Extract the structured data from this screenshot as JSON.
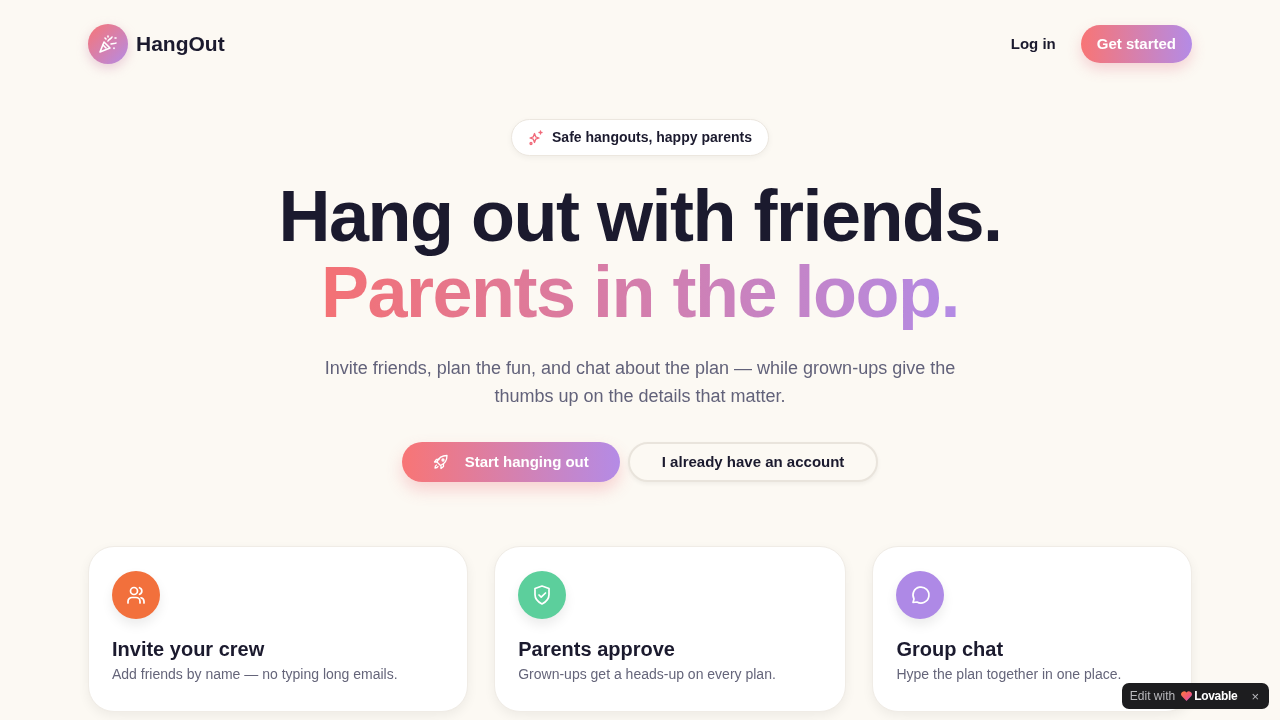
{
  "nav": {
    "brand": "HangOut",
    "login": "Log in",
    "cta": "Get started"
  },
  "hero": {
    "badge": "Safe hangouts, happy parents",
    "headline": "Hang out with friends.",
    "headline_accent": "Parents in the loop.",
    "lead": "Invite friends, plan the fun, and chat about the plan — while grown-ups give the thumbs up on the details that matter.",
    "primary_button": "Start hanging out",
    "secondary_button": "I already have an account"
  },
  "features": [
    {
      "title": "Invite your crew",
      "text": "Add friends by name — no typing long emails.",
      "color": "#f2703c"
    },
    {
      "title": "Parents approve",
      "text": "Grown-ups get a heads-up on every plan.",
      "color": "#5ccf9c"
    },
    {
      "title": "Group chat",
      "text": "Hype the plan together in one place.",
      "color": "#ae89e6"
    }
  ],
  "edit_badge": {
    "prefix": "Edit with",
    "brand": "Lovable",
    "close": "×"
  }
}
